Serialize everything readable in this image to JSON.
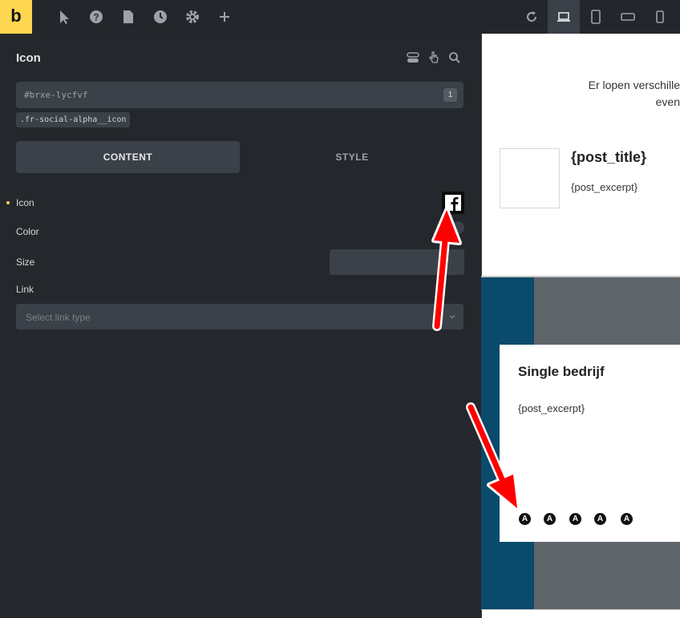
{
  "toolbar": {
    "logo": "b",
    "icons": [
      "pointer-icon",
      "help-icon",
      "page-icon",
      "history-icon",
      "settings-icon",
      "add-icon"
    ],
    "right_icons": [
      "refresh-icon",
      "laptop-icon",
      "tablet-portrait-icon",
      "tablet-landscape-icon",
      "mobile-icon"
    ],
    "active_device": "laptop"
  },
  "panel": {
    "title": "Icon",
    "header_icons": [
      "toggle-icon",
      "hand-pointer-icon",
      "search-icon"
    ],
    "element_id": "#brxe-lycfvf",
    "id_count": "1",
    "class_chip": ".fr-social-alpha__icon",
    "tabs": {
      "content": "CONTENT",
      "style": "STYLE"
    },
    "controls": {
      "icon_label": "Icon",
      "color_label": "Color",
      "size_label": "Size",
      "link_label": "Link",
      "link_placeholder": "Select link type"
    }
  },
  "preview": {
    "intro_line1": "Er lopen verschille",
    "intro_line2": "even",
    "post_title": "{post_title}",
    "post_excerpt": "{post_excerpt}",
    "card_title": "Single bedrijf",
    "card_excerpt": "{post_excerpt}",
    "social_icons": [
      "A",
      "A",
      "A",
      "A",
      "A"
    ]
  },
  "colors": {
    "accent": "#ffd64f",
    "panel_bg": "#24282c",
    "field_bg": "#3b4148",
    "arrow": "#ff0000",
    "preview_blue": "#0a4a6b",
    "preview_gray": "#60656c"
  }
}
